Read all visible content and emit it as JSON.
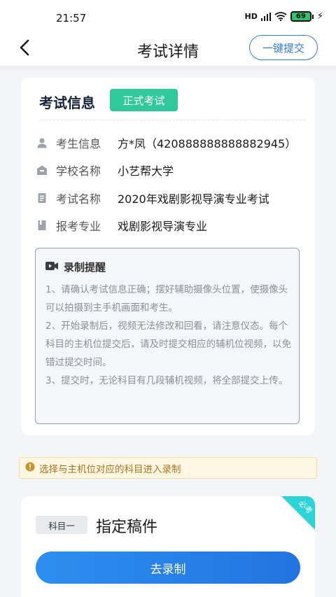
{
  "status_bar": {
    "time": "21:57",
    "signal_label": "HD",
    "battery": "69",
    "colors": {
      "battery_fill": "#2fc26b"
    }
  },
  "header": {
    "title": "考试详情",
    "back_icon": "chevron-left-icon",
    "submit_label": "一键提交"
  },
  "exam_card": {
    "title": "考试信息",
    "badge": "正式考试",
    "rows": [
      {
        "icon": "person-icon",
        "label": "考生信息",
        "value": "方*凤（420888888888882945）"
      },
      {
        "icon": "school-icon",
        "label": "学校名称",
        "value": "小艺帮大学"
      },
      {
        "icon": "document-icon",
        "label": "考试名称",
        "value": "2020年戏剧影视导演专业考试"
      },
      {
        "icon": "book-icon",
        "label": "报考专业",
        "value": "戏剧影视导演专业"
      }
    ],
    "reminder": {
      "icon": "video-icon",
      "title": "录制提醒",
      "text": "1、请确认考试信息正确；摆好辅助摄像头位置，使摄像头可以拍摄到主手机画面和考生。\n2、开始录制后，视频无法修改和回看，请注意仪态。每个科目的主机位提交后，请及时提交相应的辅机位视频，以免错过提交时间。\n3、提交时，无论科目有几段辅机视频，将全部提交上传。"
    }
  },
  "notice": {
    "icon": "warning-icon",
    "text": "选择与主机位对应的科目进入录制"
  },
  "subject_card": {
    "tag": "科目一",
    "name": "指定稿件",
    "corner_label": "必考",
    "button_label": "去录制"
  },
  "colors": {
    "accent": "#2f7be6",
    "badge_green": "#2fc99b",
    "notice_text": "#a8761e",
    "corner_cyan": "#2ed3d6"
  }
}
